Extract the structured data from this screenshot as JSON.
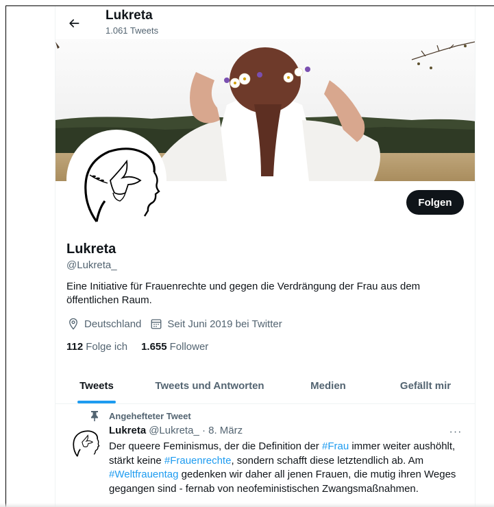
{
  "header": {
    "title": "Lukreta",
    "subtitle": "1.061 Tweets"
  },
  "profile": {
    "follow_label": "Folgen",
    "name": "Lukreta",
    "handle": "@Lukreta_",
    "bio": "Eine Initiative für Frauenrechte und gegen die Verdrängung der Frau aus dem öffentlichen Raum.",
    "location": "Deutschland",
    "joined": "Seit Juni 2019 bei Twitter",
    "following_count": "112",
    "following_label": "Folge ich",
    "followers_count": "1.655",
    "followers_label": "Follower"
  },
  "tabs": [
    {
      "label": "Tweets",
      "active": true
    },
    {
      "label": "Tweets und Antworten",
      "active": false
    },
    {
      "label": "Medien",
      "active": false
    },
    {
      "label": "Gefällt mir",
      "active": false
    }
  ],
  "pinned_tweet": {
    "pin_label": "Angehefteter Tweet",
    "author": "Lukreta",
    "handle_time": "@Lukreta_ · 8. März",
    "more": "···",
    "text_parts": [
      {
        "text": "Der queere Feminismus, der die Definition der ",
        "link": false
      },
      {
        "text": "#Frau",
        "link": true
      },
      {
        "text": " immer weiter aushöhlt, stärkt keine ",
        "link": false
      },
      {
        "text": "#Frauenrechte",
        "link": true
      },
      {
        "text": ", sondern schafft diese letztendlich ab. Am ",
        "link": false
      },
      {
        "text": "#Weltfrauentag",
        "link": true
      },
      {
        "text": " gedenken wir daher all jenen Frauen, die mutig ihren Weges gegangen sind - fernab von neofeministischen Zwangsmaßnahmen.",
        "link": false
      }
    ]
  },
  "colors": {
    "accent": "#1d9bf0",
    "text": "#0f1419",
    "muted": "#536471",
    "button_bg": "#0f1419"
  },
  "icons": [
    "back-arrow-icon",
    "location-icon",
    "calendar-icon",
    "pin-icon",
    "more-icon"
  ]
}
